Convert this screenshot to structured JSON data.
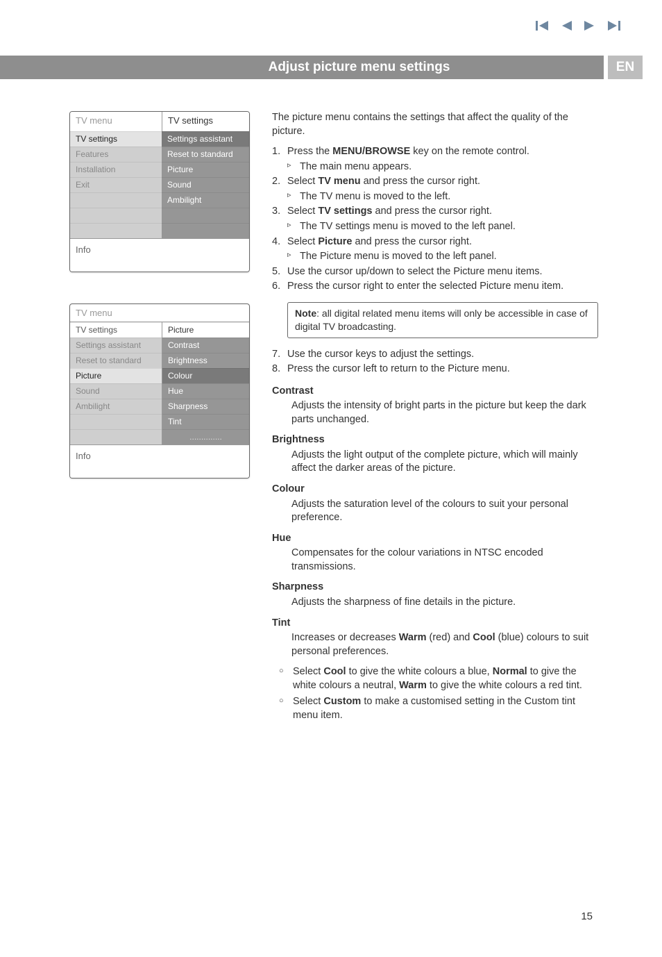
{
  "nav": {
    "first": "first",
    "prev": "prev",
    "next": "next",
    "last": "last"
  },
  "header": {
    "title": "Adjust picture menu settings",
    "lang": "EN"
  },
  "menu1": {
    "hleft": "TV menu",
    "hright": "TV settings",
    "left": {
      "i0": "TV settings",
      "i1": "Features",
      "i2": "Installation",
      "i3": "Exit"
    },
    "right": {
      "i0": "Settings assistant",
      "i1": "Reset to standard",
      "i2": "Picture",
      "i3": "Sound",
      "i4": "Ambilight"
    },
    "info": "Info"
  },
  "menu2": {
    "hleft": "TV menu",
    "hright": "",
    "sub": "TV settings",
    "subright": "Picture",
    "left": {
      "i0": "Settings assistant",
      "i1": "Reset to standard",
      "i2": "Picture",
      "i3": "Sound",
      "i4": "Ambilight"
    },
    "right": {
      "i0": "Contrast",
      "i1": "Brightness",
      "i2": "Colour",
      "i3": "Hue",
      "i4": "Sharpness",
      "i5": "Tint",
      "i6": ".............."
    },
    "info": "Info"
  },
  "body": {
    "intro": "The picture menu contains the settings that affect the quality of the picture.",
    "s1n": "1.",
    "s1a": "Press the ",
    "s1b": "MENU/BROWSE",
    "s1c": " key on the remote control.",
    "s1r": "The main menu appears.",
    "s2n": "2.",
    "s2a": "Select ",
    "s2b": "TV menu",
    "s2c": " and press the cursor right.",
    "s2r": "The TV menu is moved to the left.",
    "s3n": "3.",
    "s3a": "Select ",
    "s3b": "TV settings",
    "s3c": " and press the cursor right.",
    "s3r": "The TV settings menu is moved to the left panel.",
    "s4n": "4.",
    "s4a": "Select ",
    "s4b": "Picture",
    "s4c": " and press the cursor right.",
    "s4r": "The Picture menu is moved to the left panel.",
    "s5n": "5.",
    "s5": "Use the cursor up/down to select the Picture menu items.",
    "s6n": "6.",
    "s6": "Press the cursor right to enter the selected Picture menu item.",
    "noteHead": "Note",
    "note": ": all digital related menu items will only be accessible in case of digital TV broadcasting.",
    "s7n": "7.",
    "s7": "Use the cursor keys to adjust the settings.",
    "s8n": "8.",
    "s8": "Press the cursor left to return to the Picture menu.",
    "contrastH": "Contrast",
    "contrastB": "Adjusts the intensity of bright parts in the picture but keep the dark parts unchanged.",
    "brightH": "Brightness",
    "brightB": "Adjusts the light output of the complete picture, which will mainly affect the darker areas of the picture.",
    "colourH": "Colour",
    "colourB": "Adjusts the saturation level of the colours to suit your personal preference.",
    "hueH": "Hue",
    "hueB": "Compensates for the colour variations in NTSC encoded transmissions.",
    "sharpH": "Sharpness",
    "sharpB": "Adjusts the sharpness of fine details in the picture.",
    "tintH": "Tint",
    "tint1a": "Increases or decreases ",
    "tint1b": "Warm",
    "tint1c": " (red) and ",
    "tint1d": "Cool",
    "tint1e": " (blue) colours to suit personal preferences.",
    "tint2a": "Select ",
    "tint2b": "Cool",
    "tint2c": " to give the white colours a blue, ",
    "tint2d": "Normal",
    "tint2e": " to give the white colours a neutral, ",
    "tint2f": "Warm",
    "tint2g": " to give the white colours a red tint.",
    "tint3a": "Select ",
    "tint3b": "Custom",
    "tint3c": " to make a customised setting in the Custom tint menu item."
  },
  "pagenum": "15"
}
